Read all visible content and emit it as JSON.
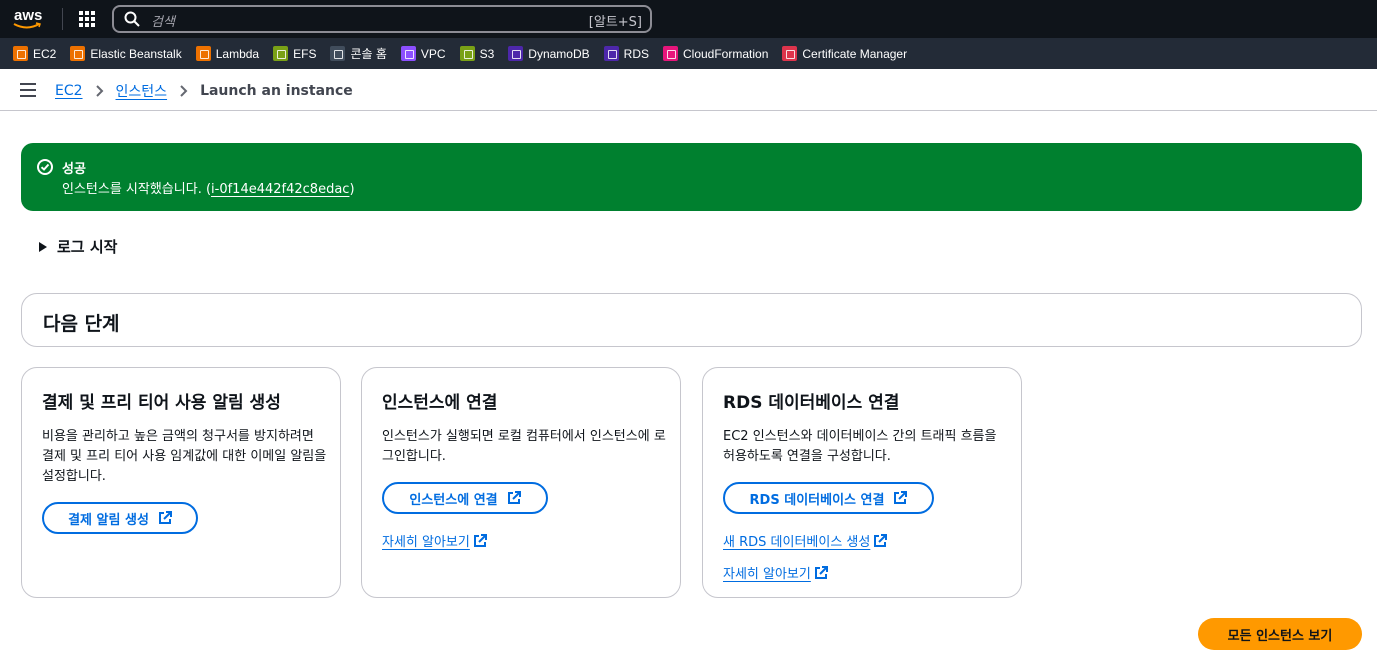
{
  "topnav": {
    "logo_text": "aws",
    "search_placeholder": "검색",
    "search_shortcut": "[알트+S]"
  },
  "favorites": [
    {
      "label": "EC2",
      "color": "#ed7100"
    },
    {
      "label": "Elastic Beanstalk",
      "color": "#ed7100"
    },
    {
      "label": "Lambda",
      "color": "#ed7100"
    },
    {
      "label": "EFS",
      "color": "#7aa116"
    },
    {
      "label": "콘솔 홈",
      "color": "#414d5c"
    },
    {
      "label": "VPC",
      "color": "#8c4fff"
    },
    {
      "label": "S3",
      "color": "#7aa116"
    },
    {
      "label": "DynamoDB",
      "color": "#4d27aa"
    },
    {
      "label": "RDS",
      "color": "#4d27aa"
    },
    {
      "label": "CloudFormation",
      "color": "#e7157b"
    },
    {
      "label": "Certificate Manager",
      "color": "#dd344c"
    }
  ],
  "breadcrumb": {
    "items": [
      "EC2",
      "인스턴스"
    ],
    "current": "Launch an instance"
  },
  "flash": {
    "title": "성공",
    "body_prefix": "인스턴스를 시작했습니다. (",
    "instance_id": "i-0f14e442f42c8edac",
    "body_suffix": ")"
  },
  "launch_log": {
    "label": "로그 시작"
  },
  "next_steps": {
    "title": "다음 단계"
  },
  "cards": [
    {
      "title": "결제 및 프리 티어 사용 알림 생성",
      "description": "비용을 관리하고 높은 금액의 청구서를 방지하려면 결제 및 프리 티어 사용 임계값에 대한 이메일 알림을 설정합니다.",
      "button": "결제 알림 생성",
      "links": []
    },
    {
      "title": "인스턴스에 연결",
      "description": "인스턴스가 실행되면 로컬 컴퓨터에서 인스턴스에 로그인합니다.",
      "button": "인스턴스에 연결",
      "links": [
        "자세히 알아보기"
      ]
    },
    {
      "title": "RDS 데이터베이스 연결",
      "description": "EC2 인스턴스와 데이터베이스 간의 트래픽 흐름을 허용하도록 연결을 구성합니다.",
      "button": "RDS 데이터베이스 연결",
      "links": [
        "새 RDS 데이터베이스 생성",
        "자세히 알아보기"
      ]
    }
  ],
  "primary_button": "모든 인스턴스 보기"
}
